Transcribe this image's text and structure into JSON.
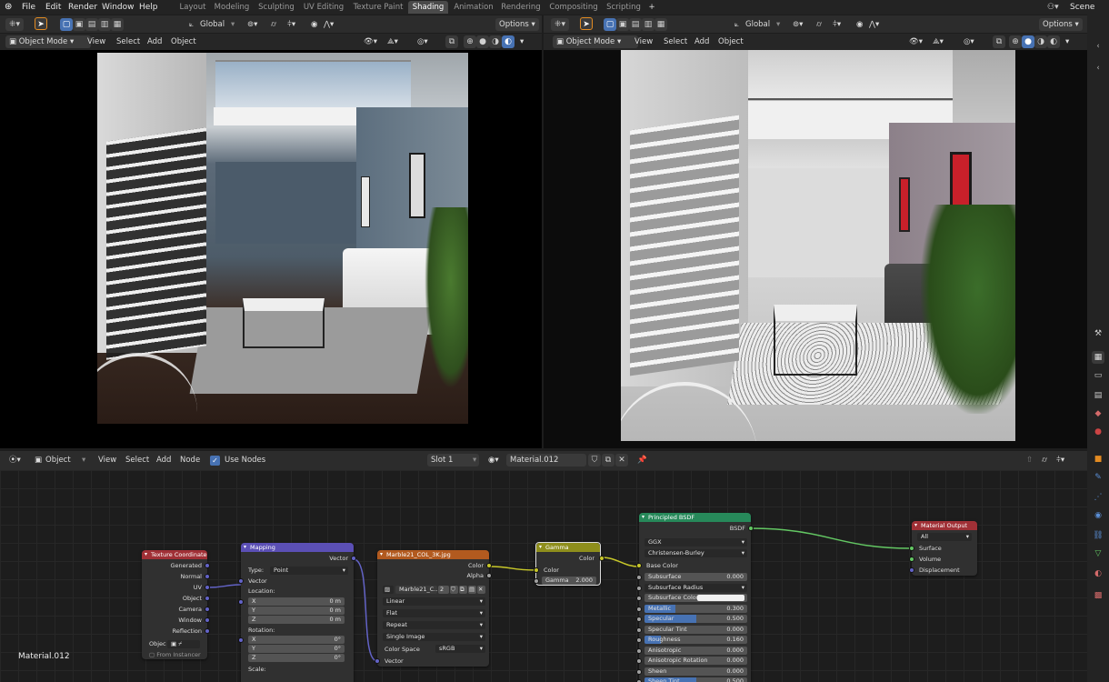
{
  "topbar": {
    "menus": [
      "File",
      "Edit",
      "Render",
      "Window",
      "Help"
    ],
    "workspaces": [
      "Layout",
      "Modeling",
      "Sculpting",
      "UV Editing",
      "Texture Paint",
      "Shading",
      "Animation",
      "Rendering",
      "Compositing",
      "Scripting"
    ],
    "active_workspace": "Shading",
    "add_tab": "+",
    "scene_label": "Scene"
  },
  "viewport_left": {
    "transform_orientation": "Global",
    "options_label": "Options",
    "mode": "Object Mode",
    "menus": [
      "View",
      "Select",
      "Add",
      "Object"
    ]
  },
  "viewport_right": {
    "transform_orientation": "Global",
    "options_label": "Options",
    "mode": "Object Mode",
    "menus": [
      "View",
      "Select",
      "Add",
      "Object"
    ]
  },
  "node_editor": {
    "editor_type": "Object",
    "menus": [
      "View",
      "Select",
      "Add",
      "Node"
    ],
    "use_nodes_label": "Use Nodes",
    "use_nodes_checked": true,
    "slot": "Slot 1",
    "material_name": "Material.012",
    "footer_material": "Material.012"
  },
  "nodes": {
    "texture_coordinate": {
      "title": "Texture Coordinate",
      "outputs": [
        "Generated",
        "Normal",
        "UV",
        "Object",
        "Camera",
        "Window",
        "Reflection"
      ],
      "object_label": "Objec",
      "from_instancer": "From Instancer"
    },
    "mapping": {
      "title": "Mapping",
      "output": "Vector",
      "type_label": "Type:",
      "type_value": "Point",
      "vector_label": "Vector",
      "location_label": "Location:",
      "location": [
        {
          "axis": "X",
          "value": "0 m"
        },
        {
          "axis": "Y",
          "value": "0 m"
        },
        {
          "axis": "Z",
          "value": "0 m"
        }
      ],
      "rotation_label": "Rotation:",
      "rotation": [
        {
          "axis": "X",
          "value": "0°"
        },
        {
          "axis": "Y",
          "value": "0°"
        },
        {
          "axis": "Z",
          "value": "0°"
        }
      ],
      "scale_label": "Scale:"
    },
    "image_texture": {
      "title": "Marble21_COL_3K.jpg",
      "outputs": [
        "Color",
        "Alpha"
      ],
      "image_name": "Marble21_C...",
      "users": "2",
      "interpolation": "Linear",
      "projection": "Flat",
      "extension": "Repeat",
      "source": "Single Image",
      "color_space_label": "Color Space",
      "color_space": "sRGB",
      "input": "Vector"
    },
    "gamma": {
      "title": "Gamma",
      "output": "Color",
      "input": "Color",
      "gamma_label": "Gamma",
      "gamma_value": "2.000"
    },
    "principled": {
      "title": "Principled BSDF",
      "output": "BSDF",
      "distribution": "GGX",
      "subsurface_method": "Christensen-Burley",
      "base_color": "Base Color",
      "params": [
        {
          "label": "Subsurface",
          "value": "0.000",
          "fill": 0
        },
        {
          "label": "Subsurface Radius",
          "value": "",
          "fill": 0
        },
        {
          "label": "Subsurface Color",
          "value": "",
          "fill": 0
        },
        {
          "label": "Metallic",
          "value": "0.300",
          "fill": 0.3
        },
        {
          "label": "Specular",
          "value": "0.500",
          "fill": 0.5
        },
        {
          "label": "Specular Tint",
          "value": "0.000",
          "fill": 0
        },
        {
          "label": "Roughness",
          "value": "0.160",
          "fill": 0.16
        },
        {
          "label": "Anisotropic",
          "value": "0.000",
          "fill": 0
        },
        {
          "label": "Anisotropic Rotation",
          "value": "0.000",
          "fill": 0
        },
        {
          "label": "Sheen",
          "value": "0.000",
          "fill": 0
        },
        {
          "label": "Sheen Tint",
          "value": "0.500",
          "fill": 0.5
        }
      ]
    },
    "material_output": {
      "title": "Material Output",
      "target": "All",
      "inputs": [
        "Surface",
        "Volume",
        "Displacement"
      ]
    }
  },
  "colors": {
    "accent_blue": "#4772b3",
    "active_orange": "#e38b22",
    "node_texture_header": "#b25a1f",
    "node_vector_header": "#5b4fb5",
    "node_input_header": "#a03036",
    "node_color_header": "#8e8e1c",
    "node_shader_header": "#27895a",
    "node_output_header": "#a03036"
  }
}
